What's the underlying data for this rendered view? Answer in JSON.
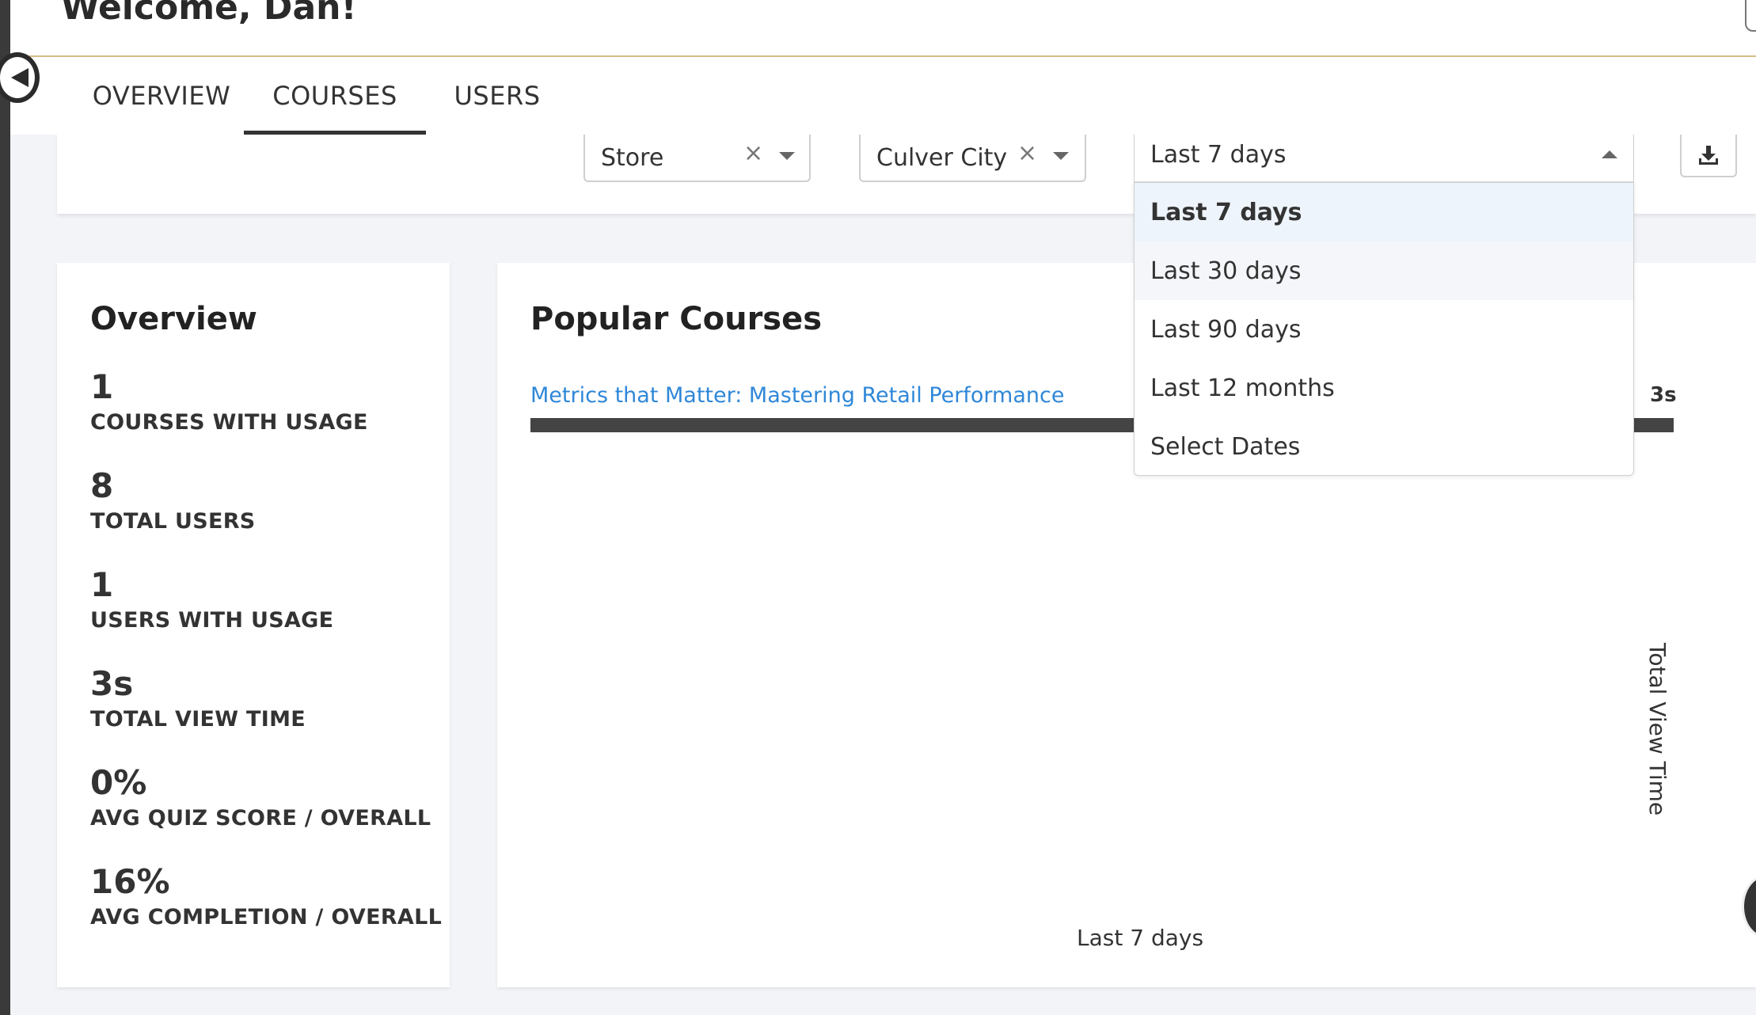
{
  "header": {
    "welcome": "Welcome, Dan!"
  },
  "tabs": [
    {
      "label": "OVERVIEW",
      "active": false
    },
    {
      "label": "COURSES",
      "active": true
    },
    {
      "label": "USERS",
      "active": false
    }
  ],
  "filters": {
    "store": {
      "value": "Store",
      "clear": "×"
    },
    "location": {
      "value": "Culver City",
      "clear": "×"
    },
    "date": {
      "value": "Last 7 days",
      "options": [
        "Last 7 days",
        "Last 30 days",
        "Last 90 days",
        "Last 12 months",
        "Select Dates"
      ],
      "selected_option": "Last 7 days",
      "hovered_option": "Last 30 days"
    }
  },
  "overview": {
    "title": "Overview",
    "stats": [
      {
        "value": "1",
        "label": "COURSES WITH USAGE"
      },
      {
        "value": "8",
        "label": "TOTAL USERS"
      },
      {
        "value": "1",
        "label": "USERS WITH USAGE"
      },
      {
        "value": "3s",
        "label": "TOTAL VIEW TIME"
      },
      {
        "value": "0%",
        "label": "AVG QUIZ SCORE / OVERALL"
      },
      {
        "value": "16%",
        "label": "AVG COMPLETION / OVERALL"
      }
    ]
  },
  "popular": {
    "title": "Popular Courses",
    "chart_data": {
      "type": "bar",
      "orientation": "horizontal",
      "categories": [
        "Metrics that Matter: Mastering Retail Performance"
      ],
      "values": [
        3
      ],
      "value_labels": [
        "3s"
      ],
      "xlabel": "Last 7 days",
      "ylabel": "Total View Time"
    }
  },
  "colors": {
    "accent_link": "#2f87d8",
    "bar": "#444444",
    "header_rule": "#d4bf8a",
    "selected_option_bg": "#eef4fb"
  },
  "icons": {
    "collapse": "chevron-left-icon",
    "download": "download-icon",
    "clear": "close-icon",
    "caret": "caret-down-icon"
  }
}
